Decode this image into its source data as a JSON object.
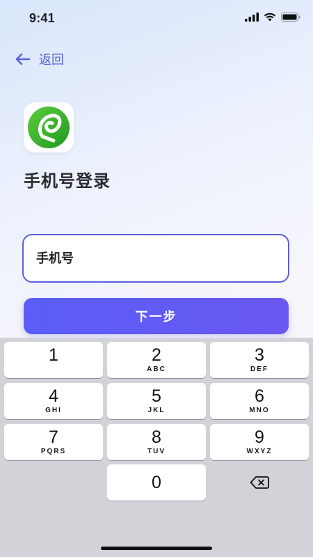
{
  "status_bar": {
    "time": "9:41"
  },
  "nav": {
    "back_label": "返回"
  },
  "page": {
    "title": "手机号登录"
  },
  "phone_input": {
    "placeholder": "手机号",
    "value": ""
  },
  "next_button": {
    "label": "下一步"
  },
  "keypad": {
    "keys": [
      {
        "num": "1",
        "letters": ""
      },
      {
        "num": "2",
        "letters": "ABC"
      },
      {
        "num": "3",
        "letters": "DEF"
      },
      {
        "num": "4",
        "letters": "GHI"
      },
      {
        "num": "5",
        "letters": "JKL"
      },
      {
        "num": "6",
        "letters": "MNO"
      },
      {
        "num": "7",
        "letters": "PQRS"
      },
      {
        "num": "8",
        "letters": "TUV"
      },
      {
        "num": "9",
        "letters": "WXYZ"
      },
      {
        "num": "0",
        "letters": ""
      }
    ],
    "delete_icon": "backspace-icon"
  },
  "colors": {
    "accent": "#5b5fd9",
    "button_start": "#5a5df7",
    "button_end": "#6a58f2",
    "logo_green": "#2fb12a"
  }
}
